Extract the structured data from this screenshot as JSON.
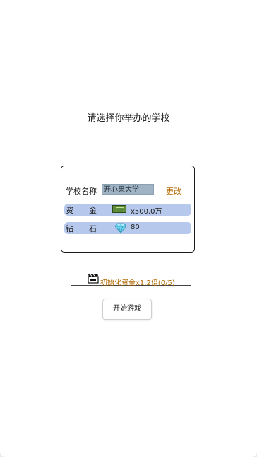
{
  "page": {
    "title": "请选择你举办的学校"
  },
  "school_card": {
    "name_label": "学校名称",
    "name_value": "开心果大学",
    "change_label": "更改",
    "funds": {
      "label_part1": "资",
      "label_part2": "金",
      "icon": "money-icon",
      "value": "x500.0万"
    },
    "diamonds": {
      "label_part1": "钻",
      "label_part2": "石",
      "icon": "diamond-icon",
      "value": "80"
    }
  },
  "bonus_hint": {
    "icon": "film-icon",
    "text": "初始化资金x1.2倍(0/5)"
  },
  "start_button": {
    "label": "开始游戏"
  },
  "colors": {
    "accent": "#b56a00",
    "row_bg": "#b6c8ec",
    "input_bg": "#9fb3c4"
  }
}
